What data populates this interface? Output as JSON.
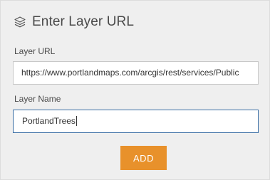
{
  "header": {
    "icon": "layers-icon",
    "title": "Enter Layer URL"
  },
  "form": {
    "url_label": "Layer URL",
    "url_value": "https://www.portlandmaps.com/arcgis/rest/services/Public",
    "name_label": "Layer Name",
    "name_value": "PortlandTrees"
  },
  "actions": {
    "add_label": "ADD"
  },
  "colors": {
    "panel_bg": "#efefef",
    "accent_button": "#e8912b",
    "focus_border": "#3a6ea5"
  }
}
